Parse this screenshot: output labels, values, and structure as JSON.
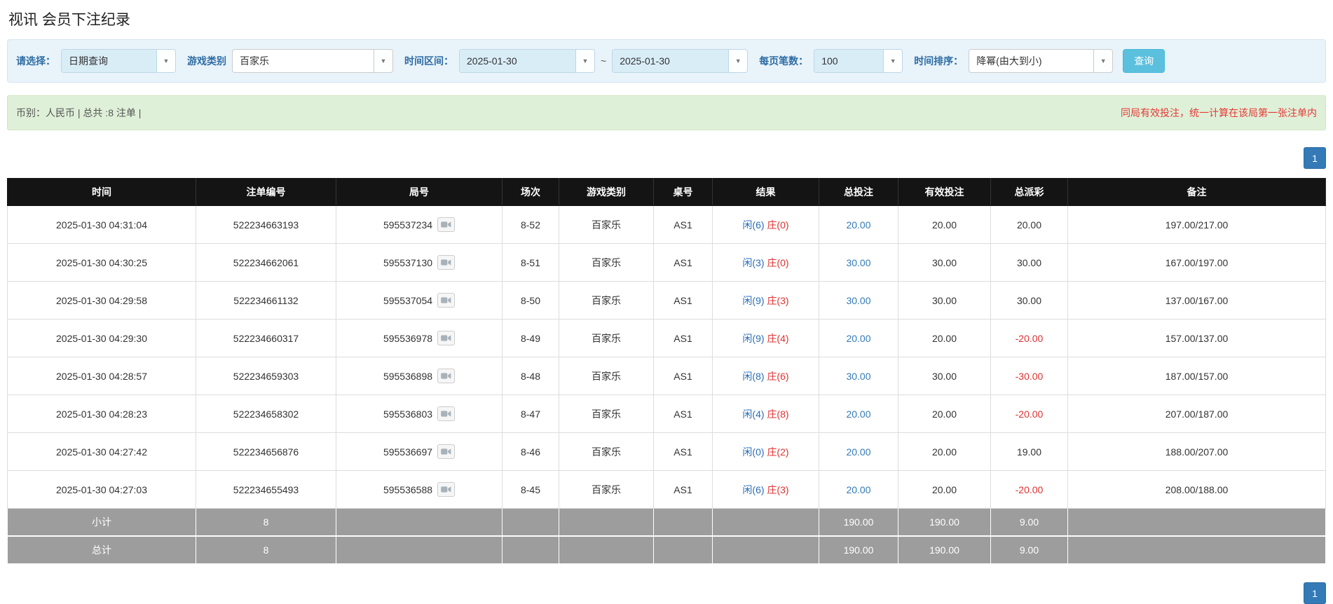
{
  "page": {
    "title": "视讯 会员下注纪录"
  },
  "filters": {
    "select_label": "请选择：",
    "select_value": "日期查询",
    "game_label": "游戏类别",
    "game_value": "百家乐",
    "range_label": "时间区间：",
    "date_from": "2025-01-30",
    "range_separator": "~",
    "date_to": "2025-01-30",
    "per_page_label": "每页笔数：",
    "per_page_value": "100",
    "sort_label": "时间排序：",
    "sort_value": "降幂(由大到小)",
    "search_button": "查询"
  },
  "summary": {
    "left": "币别：人民币 | 总共 :8 注单 |",
    "right": "同局有效投注，统一计算在该局第一张注单内"
  },
  "pagination": {
    "page": "1"
  },
  "icons": {
    "caret": "▼"
  },
  "colors": {
    "accent_blue": "#337ab7",
    "player_blue": "#2a6db5",
    "banker_red": "#e03131",
    "negative_red": "#e03131",
    "header_bg": "#141414",
    "footer_bg": "#9d9d9d",
    "search_btn": "#5bc0de",
    "summary_bg": "#dff0d8",
    "filter_bg": "#e9f3fa"
  },
  "table": {
    "headers": [
      "时间",
      "注单编号",
      "局号",
      "场次",
      "游戏类别",
      "桌号",
      "结果",
      "总投注",
      "有效投注",
      "总派彩",
      "备注"
    ],
    "rows": [
      {
        "time": "2025-01-30 04:31:04",
        "bet_id": "522234663193",
        "round_id": "595537234",
        "session": "8-52",
        "game": "百家乐",
        "table_no": "AS1",
        "result_player": "闲(6)",
        "result_banker": "庄(0)",
        "total_bet": "20.00",
        "valid_bet": "20.00",
        "payout": "20.00",
        "note": "197.00/217.00"
      },
      {
        "time": "2025-01-30 04:30:25",
        "bet_id": "522234662061",
        "round_id": "595537130",
        "session": "8-51",
        "game": "百家乐",
        "table_no": "AS1",
        "result_player": "闲(3)",
        "result_banker": "庄(0)",
        "total_bet": "30.00",
        "valid_bet": "30.00",
        "payout": "30.00",
        "note": "167.00/197.00"
      },
      {
        "time": "2025-01-30 04:29:58",
        "bet_id": "522234661132",
        "round_id": "595537054",
        "session": "8-50",
        "game": "百家乐",
        "table_no": "AS1",
        "result_player": "闲(9)",
        "result_banker": "庄(3)",
        "total_bet": "30.00",
        "valid_bet": "30.00",
        "payout": "30.00",
        "note": "137.00/167.00"
      },
      {
        "time": "2025-01-30 04:29:30",
        "bet_id": "522234660317",
        "round_id": "595536978",
        "session": "8-49",
        "game": "百家乐",
        "table_no": "AS1",
        "result_player": "闲(9)",
        "result_banker": "庄(4)",
        "total_bet": "20.00",
        "valid_bet": "20.00",
        "payout": "-20.00",
        "note": "157.00/137.00"
      },
      {
        "time": "2025-01-30 04:28:57",
        "bet_id": "522234659303",
        "round_id": "595536898",
        "session": "8-48",
        "game": "百家乐",
        "table_no": "AS1",
        "result_player": "闲(8)",
        "result_banker": "庄(6)",
        "total_bet": "30.00",
        "valid_bet": "30.00",
        "payout": "-30.00",
        "note": "187.00/157.00"
      },
      {
        "time": "2025-01-30 04:28:23",
        "bet_id": "522234658302",
        "round_id": "595536803",
        "session": "8-47",
        "game": "百家乐",
        "table_no": "AS1",
        "result_player": "闲(4)",
        "result_banker": "庄(8)",
        "total_bet": "20.00",
        "valid_bet": "20.00",
        "payout": "-20.00",
        "note": "207.00/187.00"
      },
      {
        "time": "2025-01-30 04:27:42",
        "bet_id": "522234656876",
        "round_id": "595536697",
        "session": "8-46",
        "game": "百家乐",
        "table_no": "AS1",
        "result_player": "闲(0)",
        "result_banker": "庄(2)",
        "total_bet": "20.00",
        "valid_bet": "20.00",
        "payout": "19.00",
        "note": "188.00/207.00"
      },
      {
        "time": "2025-01-30 04:27:03",
        "bet_id": "522234655493",
        "round_id": "595536588",
        "session": "8-45",
        "game": "百家乐",
        "table_no": "AS1",
        "result_player": "闲(6)",
        "result_banker": "庄(3)",
        "total_bet": "20.00",
        "valid_bet": "20.00",
        "payout": "-20.00",
        "note": "208.00/188.00"
      }
    ],
    "subtotal": {
      "label": "小计",
      "count": "8",
      "total_bet": "190.00",
      "valid_bet": "190.00",
      "payout": "9.00"
    },
    "grand_total": {
      "label": "总计",
      "count": "8",
      "total_bet": "190.00",
      "valid_bet": "190.00",
      "payout": "9.00"
    }
  }
}
